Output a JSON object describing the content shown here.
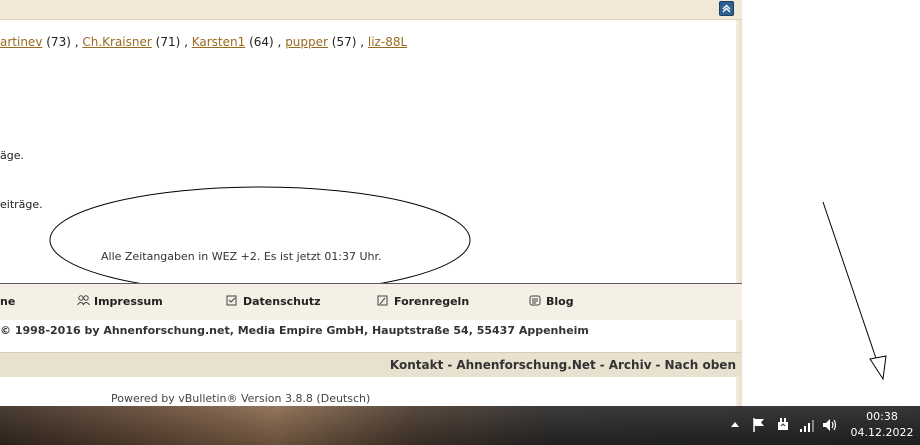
{
  "forum": {
    "birthdays": [
      {
        "name": "artinev",
        "age": "(73)"
      },
      {
        "name": "Ch.Kraisner",
        "age": "(71)"
      },
      {
        "name": "Karsten1",
        "age": "(64)"
      },
      {
        "name": "pupper",
        "age": "(57)"
      },
      {
        "name": "liz-88L",
        "age": ""
      }
    ],
    "separator": " , ",
    "msg1": "äge.",
    "msg2": "eiträge.",
    "timeline": "Alle Zeitangaben in WEZ +2. Es ist jetzt 01:37 Uhr."
  },
  "footer_nav": {
    "home": "ne",
    "impressum": "Impressum",
    "datenschutz": "Datenschutz",
    "forenregeln": "Forenregeln",
    "blog": "Blog"
  },
  "copyright": "© 1998-2016 by Ahnenforschung.net, Media Empire GmbH, Hauptstraße 54, 55437 Appenheim",
  "links": {
    "kontakt": "Kontakt",
    "home": "Ahnenforschung.Net",
    "archiv": "Archiv",
    "top": "Nach oben",
    "sep": "-"
  },
  "powered": "Powered by vBulletin® Version 3.8.8 (Deutsch)",
  "taskbar": {
    "time": "00:38",
    "date": "04.12.2022",
    "icons": [
      "show-hidden-icons-icon",
      "action-center-flag-icon",
      "power-plug-icon",
      "network-signal-icon",
      "volume-icon"
    ]
  },
  "colors": {
    "link": "#9b6b21",
    "header_bg": "#f1e8d6",
    "footer_bg": "#e9e1cf"
  }
}
